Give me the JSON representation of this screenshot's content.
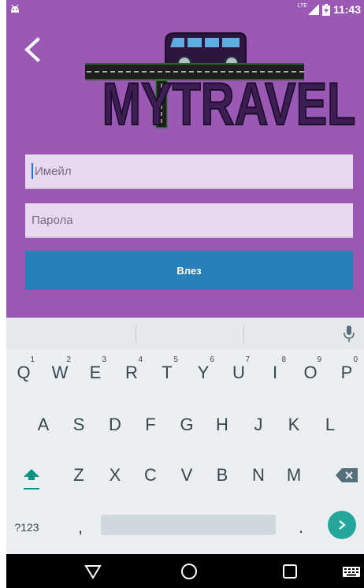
{
  "status_bar": {
    "time": "11:43",
    "network": "LTE"
  },
  "logo": {
    "text": "MYTRAVEL"
  },
  "form": {
    "email_placeholder": "Имейл",
    "password_placeholder": "Парола",
    "login_label": "Влез"
  },
  "keyboard": {
    "row1": [
      {
        "k": "Q",
        "n": "1"
      },
      {
        "k": "W",
        "n": "2"
      },
      {
        "k": "E",
        "n": "3"
      },
      {
        "k": "R",
        "n": "4"
      },
      {
        "k": "T",
        "n": "5"
      },
      {
        "k": "Y",
        "n": "6"
      },
      {
        "k": "U",
        "n": "7"
      },
      {
        "k": "I",
        "n": "8"
      },
      {
        "k": "O",
        "n": "9"
      },
      {
        "k": "P",
        "n": "0"
      }
    ],
    "row2": [
      "A",
      "S",
      "D",
      "F",
      "G",
      "H",
      "J",
      "K",
      "L"
    ],
    "row3": [
      "Z",
      "X",
      "C",
      "V",
      "B",
      "N",
      "M"
    ],
    "symbols_label": "?123",
    "comma": ",",
    "period": "."
  },
  "colors": {
    "app_bg": "#9b59b6",
    "button": "#2980b9",
    "enter_key": "#26a69a",
    "shift_accent": "#009688"
  }
}
